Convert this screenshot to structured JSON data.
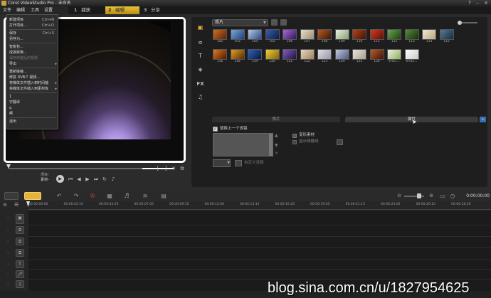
{
  "titlebar": {
    "title": "Corel VideoStudio Pro - 未命名",
    "minimize": "–",
    "maximize": "□",
    "close": "×",
    "help": "?"
  },
  "menubar": {
    "items": [
      "文件",
      "编辑",
      "工具",
      "设置"
    ]
  },
  "steps": [
    {
      "num": "1",
      "label": "捕获"
    },
    {
      "num": "2",
      "label": "编辑"
    },
    {
      "num": "3",
      "label": "分享"
    }
  ],
  "file_menu": {
    "items": [
      {
        "label": "新建项目",
        "shortcut": "Ctrl+N",
        "disabled": false
      },
      {
        "label": "打开项目...",
        "shortcut": "Ctrl+O",
        "disabled": false
      },
      {
        "sep": true
      },
      {
        "label": "保存",
        "shortcut": "Ctrl+S",
        "disabled": false
      },
      {
        "label": "另存为...",
        "shortcut": "",
        "disabled": false
      },
      {
        "sep": true
      },
      {
        "label": "智能包...",
        "shortcut": "",
        "disabled": false
      },
      {
        "label": "成批转换...",
        "shortcut": "",
        "disabled": false
      },
      {
        "label": "保存修整后的视频",
        "shortcut": "",
        "disabled": true
      },
      {
        "label": "导出",
        "shortcut": "",
        "sub": true,
        "disabled": false
      },
      {
        "sep": true
      },
      {
        "label": "重新链接...",
        "shortcut": "",
        "disabled": false
      },
      {
        "label": "修复 DVB-T 视频...",
        "shortcut": "",
        "disabled": false
      },
      {
        "label": "将媒体文件插入到时间轴",
        "shortcut": "",
        "sub": true,
        "disabled": false
      },
      {
        "label": "将媒体文件插入到素材库",
        "shortcut": "",
        "sub": true,
        "disabled": false
      },
      {
        "sep": true
      },
      {
        "label": "1",
        "shortcut": "",
        "disabled": false
      },
      {
        "label": "宇翻译",
        "shortcut": "",
        "disabled": false
      },
      {
        "label": "q",
        "shortcut": "",
        "disabled": false
      },
      {
        "label": "啊",
        "shortcut": "",
        "disabled": false
      },
      {
        "sep": true
      },
      {
        "label": "退出",
        "shortcut": "",
        "disabled": false
      }
    ]
  },
  "player": {
    "mode_project": "项目-",
    "mode_clip": "素材-"
  },
  "library": {
    "folder": "照片",
    "thumbs_row1": [
      {
        "label": "102",
        "c1": "#d0701e",
        "c2": "#5a2008"
      },
      {
        "label": "103",
        "c1": "#7ba8d8",
        "c2": "#1c3e78"
      },
      {
        "label": "104",
        "c1": "#b8c8e0",
        "c2": "#2a4c8a"
      },
      {
        "label": "105",
        "c1": "#3a5fa8",
        "c2": "#0a1c48"
      },
      {
        "label": "106",
        "c1": "#a86ad8",
        "c2": "#321460"
      },
      {
        "label": "107",
        "c1": "#e8e0d0",
        "c2": "#9a8a70"
      },
      {
        "label": "108",
        "c1": "#b85a20",
        "c2": "#3a1a08"
      },
      {
        "label": "109",
        "c1": "#e8f0e0",
        "c2": "#88a070"
      },
      {
        "label": "110",
        "c1": "#b8401a",
        "c2": "#3c1408"
      },
      {
        "label": "111",
        "c1": "#d83a20",
        "c2": "#5a1008"
      },
      {
        "label": "112",
        "c1": "#6aa850",
        "c2": "#1c4010"
      },
      {
        "label": "113",
        "c1": "#5a8a3a",
        "c2": "#16300c"
      },
      {
        "label": "114",
        "c1": "#f0e8d0",
        "c2": "#b8a880"
      },
      {
        "label": "115",
        "c1": "#5a7a9a",
        "c2": "#1a2a3a"
      }
    ],
    "thumbs_row2": [
      {
        "label": "116",
        "c1": "#e8781e",
        "c2": "#4a1a04"
      },
      {
        "label": "118",
        "c1": "#e0a020",
        "c2": "#5a2a06"
      },
      {
        "label": "119",
        "c1": "#3060c0",
        "c2": "#08183c"
      },
      {
        "label": "120",
        "c1": "#f0d030",
        "c2": "#806010"
      },
      {
        "label": "121",
        "c1": "#8060c0",
        "c2": "#201040"
      },
      {
        "label": "122",
        "c1": "#e8d8c0",
        "c2": "#a08060"
      },
      {
        "label": "123",
        "c1": "#e0e0e8",
        "c2": "#9898a8"
      },
      {
        "label": "124",
        "c1": "#c0c8e0",
        "c2": "#505880"
      },
      {
        "label": "125",
        "c1": "#e8e4d8",
        "c2": "#a8a090"
      },
      {
        "label": "126",
        "c1": "#c05a28",
        "c2": "#3a1408"
      },
      {
        "label": "erst1...",
        "c1": "#f0f0e0",
        "c2": "#90b060"
      },
      {
        "label": "erst1...",
        "c1": "#ffffff",
        "c2": "#c8c8c8"
      }
    ],
    "tab_photo": "照片",
    "tab_attributes": "属性",
    "replace_last_filter": "替换上一个滤镜",
    "custom_clip": "变形素材",
    "deinterlace": "显示网格线",
    "custom_filter": "自定义滤镜"
  },
  "timeline": {
    "timecode": "0:00:00:00",
    "ticks": [
      "00:00:00:00",
      "00:00:02:10",
      "00:00:04:20",
      "00:00:07:05",
      "00:00:09:15",
      "00:00:12:00",
      "00:00:14:10",
      "00:00:16:20",
      "00:00:19:05",
      "00:00:21:15",
      "00:00:24:00",
      "00:00:26:10",
      "00:00:28:20"
    ]
  },
  "watermark": "blog.sina.com.cn/u/1827954625",
  "colors": {
    "accent": "#e3b33a",
    "background": "#2b2b2b",
    "panel": "#1e1e1e",
    "tab_highlight": "#3b6db0"
  }
}
